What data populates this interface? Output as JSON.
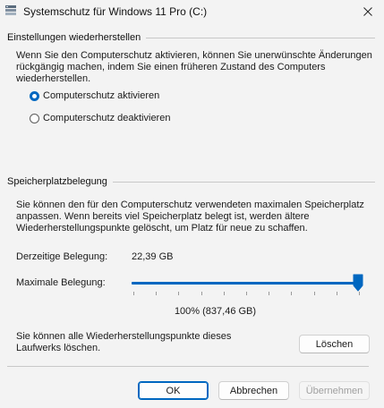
{
  "window": {
    "title": "Systemschutz für Windows 11 Pro (C:)",
    "icon": "system-protection-icon",
    "close_icon": "close-icon"
  },
  "restore": {
    "header": "Einstellungen wiederherstellen",
    "description_lines": [
      "Wenn Sie den Computerschutz aktivieren, können Sie unerwünschte Änderungen",
      "rückgängig machen, indem Sie einen früheren Zustand des Computers",
      "wiederherstellen."
    ],
    "options": [
      {
        "label": "Computerschutz aktivieren",
        "selected": true
      },
      {
        "label": "Computerschutz deaktivieren",
        "selected": false
      }
    ]
  },
  "storage": {
    "header": "Speicherplatzbelegung",
    "description_lines": [
      "Sie können den für den Computerschutz verwendeten maximalen Speicherplatz",
      "anpassen. Wenn bereits viel Speicherplatz belegt ist, werden ältere",
      "Wiederherstellungspunkte gelöscht, um Platz für neue zu schaffen."
    ],
    "current_label": "Derzeitige Belegung:",
    "current_value": "22,39 GB",
    "max_label": "Maximale Belegung:",
    "slider_level_percent": 100,
    "percent_text": "100% (837,46 GB)"
  },
  "delete": {
    "description_lines": [
      "Sie können alle Wiederherstellungspunkte dieses",
      "Laufwerks löschen."
    ],
    "button_label": "Löschen"
  },
  "footer": {
    "ok_label": "OK",
    "cancel_label": "Abbrechen",
    "apply_label": "Übernehmen"
  },
  "colors": {
    "accent": "#0067c0",
    "background": "#f3f3f3"
  }
}
